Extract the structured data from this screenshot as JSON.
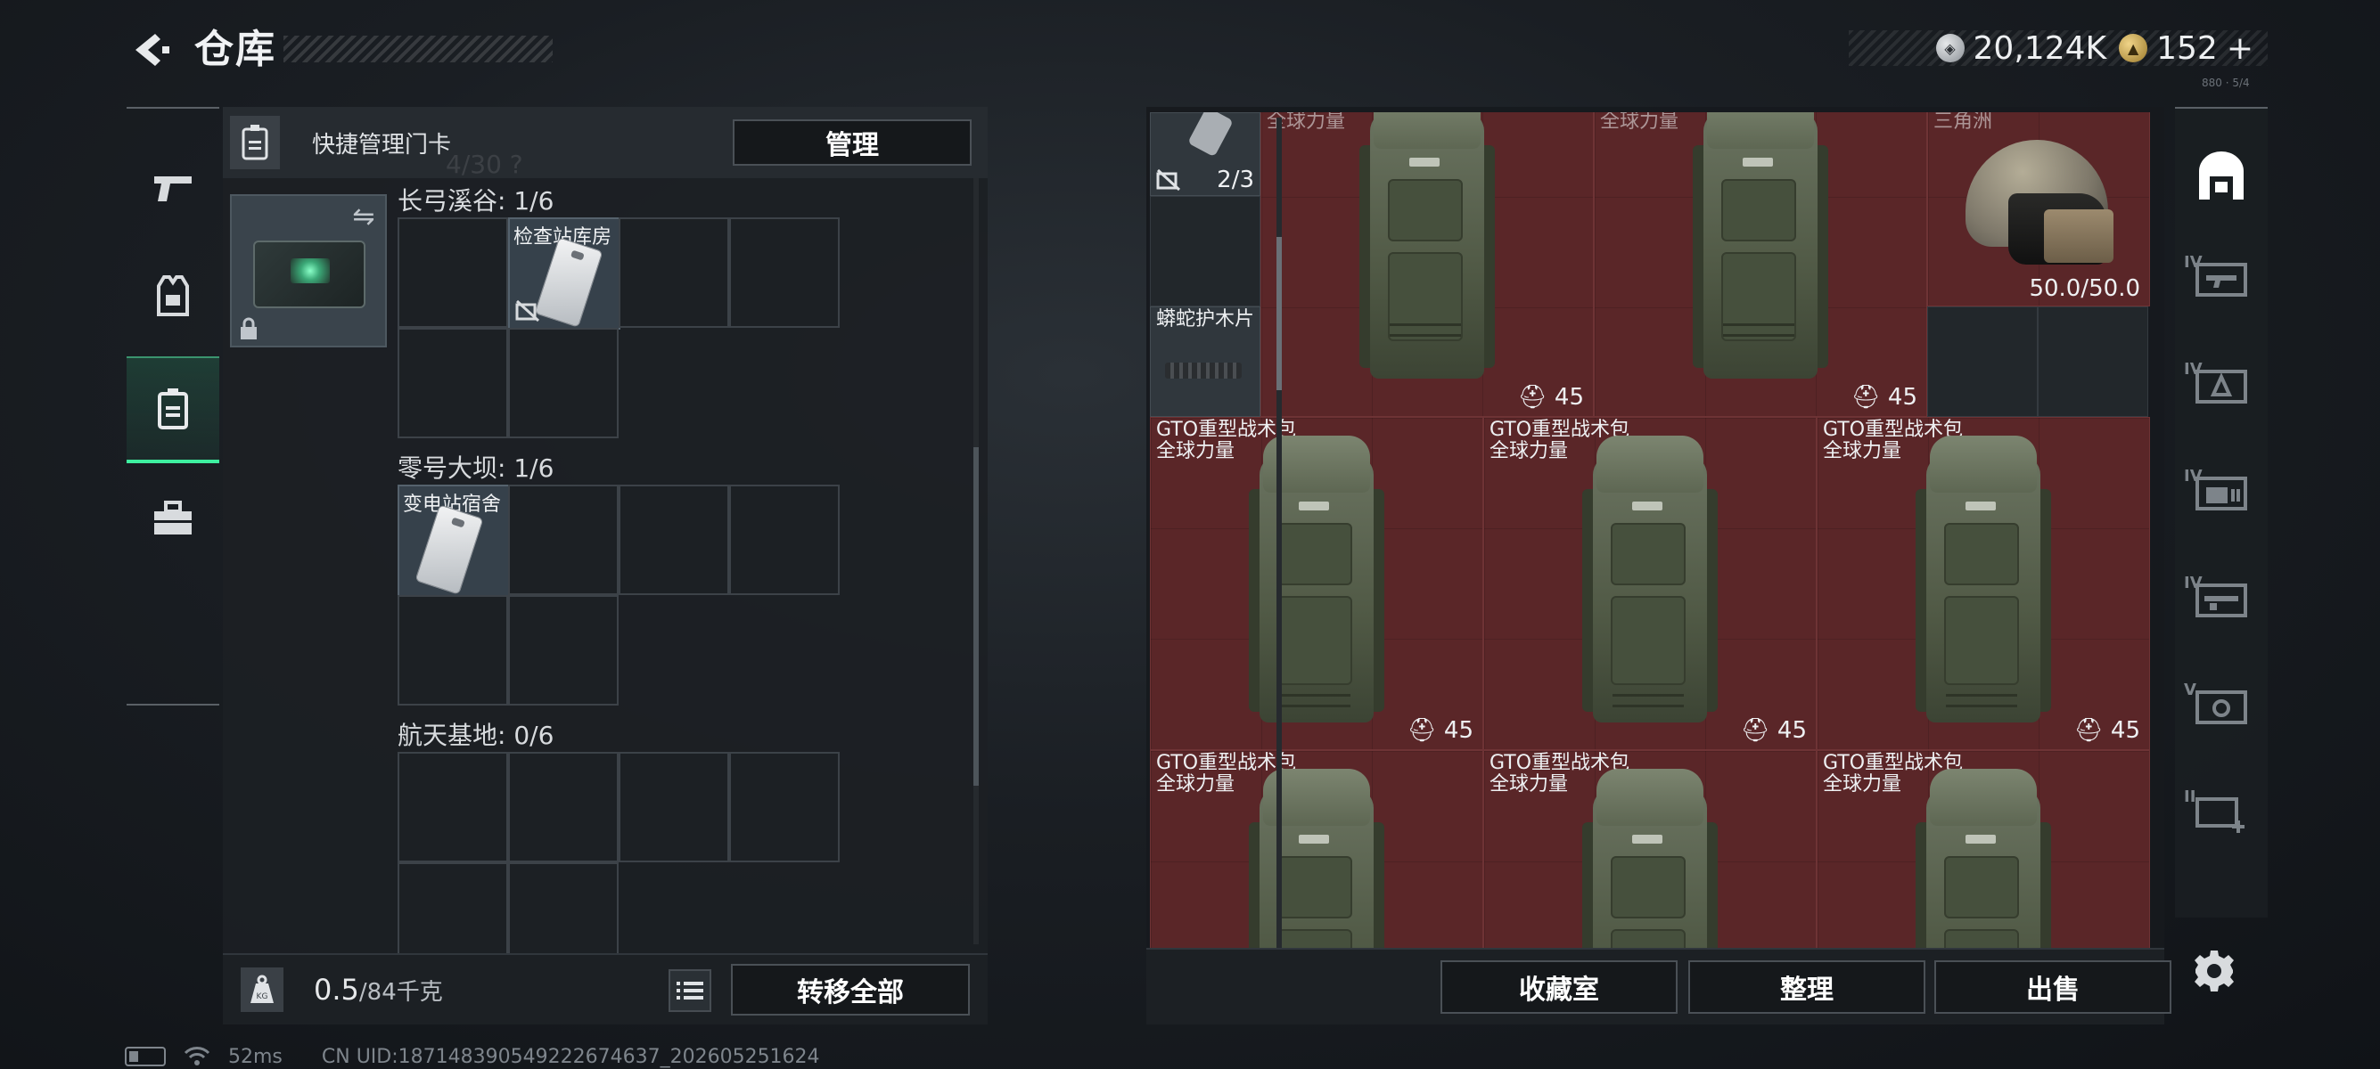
{
  "header": {
    "title": "仓库",
    "currency_silver": "20,124K",
    "currency_gold": "152",
    "currency_gold_add": "+",
    "version_text": "880 · 5/4"
  },
  "left_nav": {
    "items": [
      {
        "name": "weapons",
        "icon": "pistol-icon"
      },
      {
        "name": "equipment",
        "icon": "vest-icon"
      },
      {
        "name": "keycards",
        "icon": "keycard-icon",
        "active": true
      },
      {
        "name": "toolbox",
        "icon": "toolbox-icon"
      }
    ]
  },
  "keycard_panel": {
    "header_label": "快捷管理门卡",
    "manage_button": "管理",
    "faded_text": "4/30 ?",
    "regions": [
      {
        "label": "长弓溪谷: 1/6",
        "items": [
          {
            "label": "检查站库房",
            "no_card": true
          }
        ]
      },
      {
        "label": "零号大坝: 1/6",
        "items": [
          {
            "label": "变电站宿舍"
          }
        ]
      },
      {
        "label": "航天基地: 0/6",
        "items": []
      }
    ],
    "weight_value": "0.5",
    "weight_unit": "/84千克",
    "transfer_all_button": "转移全部"
  },
  "storage": {
    "top_row": [
      {
        "label": "全球力量",
        "count": "45"
      },
      {
        "label": "全球力量",
        "count": "45"
      },
      {
        "label": "三角洲",
        "durability": "50.0/50.0"
      }
    ],
    "small_items": [
      {
        "count": "2/3"
      },
      {
        "label": "蟒蛇护木片"
      }
    ],
    "backpacks": [
      {
        "name": "GTO重型战术包",
        "brand": "全球力量",
        "count": "45"
      },
      {
        "name": "GTO重型战术包",
        "brand": "全球力量",
        "count": "45"
      },
      {
        "name": "GTO重型战术包",
        "brand": "全球力量",
        "count": "45"
      },
      {
        "name": "GTO重型战术包",
        "brand": "全球力量"
      },
      {
        "name": "GTO重型战术包",
        "brand": "全球力量"
      },
      {
        "name": "GTO重型战术包",
        "brand": "全球力量"
      }
    ],
    "buttons": {
      "collection": "收藏室",
      "sort": "整理",
      "sell": "出售"
    }
  },
  "right_tabs": [
    {
      "icon": "storage-home-icon",
      "active": true
    },
    {
      "level": "IV",
      "icon": "weapon-case-icon"
    },
    {
      "level": "IV",
      "icon": "ammo-case-icon"
    },
    {
      "level": "IV",
      "icon": "medical-case-icon"
    },
    {
      "level": "IV",
      "icon": "gear-case-icon"
    },
    {
      "level": "V",
      "icon": "safe-case-icon"
    },
    {
      "level": "II",
      "icon": "add-case-icon"
    }
  ],
  "status_bar": {
    "ping": "52ms",
    "uid": "CN UID:18714839054922267463​7_202605251624"
  },
  "colors": {
    "accent_green": "#3ef0a0",
    "rare_red": "#5a2628"
  }
}
